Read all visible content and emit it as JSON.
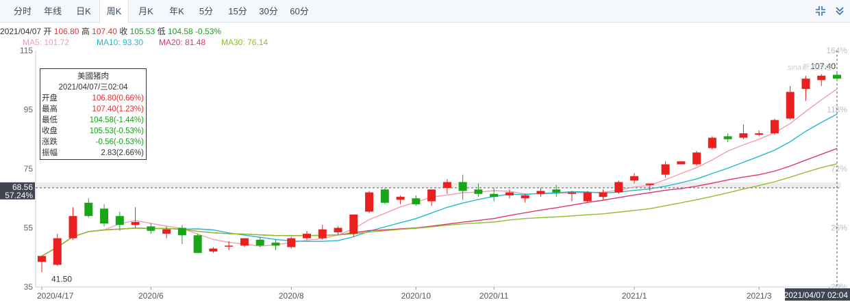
{
  "tabs": [
    {
      "label": "分时",
      "active": false
    },
    {
      "label": "年线",
      "active": false
    },
    {
      "label": "日K",
      "active": false
    },
    {
      "label": "周K",
      "active": true
    },
    {
      "label": "月K",
      "active": false
    },
    {
      "label": "年K",
      "active": false
    },
    {
      "label": "5分",
      "active": false
    },
    {
      "label": "15分",
      "active": false
    },
    {
      "label": "30分",
      "active": false
    },
    {
      "label": "60分",
      "active": false
    }
  ],
  "toolbar": {
    "compress_icon": "compress-icon",
    "arrow_icon": "chevron-down-icon"
  },
  "info": {
    "date": "2021/04/07",
    "open_label": "开",
    "open": "106.80",
    "high_label": "高",
    "high": "107.40",
    "close_label": "收",
    "close": "105.53",
    "low_label": "低",
    "low": "104.58",
    "change_pct": "-0.53%"
  },
  "ma": [
    {
      "label": "MA5: 101.72",
      "color": "#f29db0"
    },
    {
      "label": "MA10: 93.30",
      "color": "#20b8d0"
    },
    {
      "label": "MA20: 81.48",
      "color": "#e0356b"
    },
    {
      "label": "MA30: 76.14",
      "color": "#8fbf2a"
    }
  ],
  "tooltip": {
    "title": "美國猪肉",
    "datetime": "2021/04/07/三02:04",
    "rows": [
      {
        "label": "开盘",
        "value": "106.80(0.66%)",
        "color": "#e03030"
      },
      {
        "label": "最高",
        "value": "107.40(1.23%)",
        "color": "#e03030"
      },
      {
        "label": "最低",
        "value": "104.58(-1.44%)",
        "color": "#1a9e1a"
      },
      {
        "label": "收盘",
        "value": "105.53(-0.53%)",
        "color": "#1a9e1a"
      },
      {
        "label": "涨跌",
        "value": "-0.56(-0.53%)",
        "color": "#1a9e1a"
      },
      {
        "label": "振幅",
        "value": "2.83(2.66%)",
        "color": "#333333"
      }
    ]
  },
  "watermark": "sina新浪财经",
  "crosshair": {
    "price_label": "68.56",
    "pct_label": "57.24%",
    "date_label": "2021/04/07 02:04"
  },
  "chart_data": {
    "type": "candlestick",
    "y_ticks": [
      115,
      95,
      75,
      55,
      35
    ],
    "y_range": [
      35,
      115
    ],
    "pct_ticks": [
      "164%",
      "118%",
      "72%",
      "26%",
      "-20%"
    ],
    "x_tick_labels": [
      "2020/4/17",
      "2020/6",
      "2020/8",
      "2020/10",
      "2020/11",
      "2021/1",
      "2021/3"
    ],
    "x_tick_index": [
      0,
      7,
      16,
      24,
      29,
      38,
      46
    ],
    "max_label": "107.40",
    "min_label": "41.50",
    "crosshair_price": 68.56,
    "candles": [
      {
        "o": 43.5,
        "h": 45.5,
        "l": 40.0,
        "c": 45.5
      },
      {
        "o": 42.5,
        "h": 53.0,
        "l": 42.0,
        "c": 51.5
      },
      {
        "o": 51.5,
        "h": 62.0,
        "l": 51.0,
        "c": 59.0
      },
      {
        "o": 63.5,
        "h": 65.0,
        "l": 58.5,
        "c": 59.0
      },
      {
        "o": 61.5,
        "h": 63.0,
        "l": 55.5,
        "c": 56.5
      },
      {
        "o": 59.0,
        "h": 60.5,
        "l": 54.0,
        "c": 56.0
      },
      {
        "o": 56.0,
        "h": 62.0,
        "l": 55.0,
        "c": 57.0
      },
      {
        "o": 55.5,
        "h": 56.5,
        "l": 53.0,
        "c": 54.0
      },
      {
        "o": 53.0,
        "h": 55.5,
        "l": 51.5,
        "c": 54.5
      },
      {
        "o": 55.0,
        "h": 56.0,
        "l": 49.5,
        "c": 52.5
      },
      {
        "o": 52.5,
        "h": 53.0,
        "l": 46.5,
        "c": 46.5
      },
      {
        "o": 47.0,
        "h": 48.5,
        "l": 46.5,
        "c": 48.0
      },
      {
        "o": 49.0,
        "h": 50.5,
        "l": 47.5,
        "c": 49.0
      },
      {
        "o": 49.0,
        "h": 51.5,
        "l": 48.5,
        "c": 51.5
      },
      {
        "o": 51.0,
        "h": 52.0,
        "l": 48.5,
        "c": 49.0
      },
      {
        "o": 50.0,
        "h": 51.0,
        "l": 47.5,
        "c": 49.0
      },
      {
        "o": 48.5,
        "h": 52.0,
        "l": 48.0,
        "c": 51.5
      },
      {
        "o": 51.5,
        "h": 54.0,
        "l": 51.0,
        "c": 53.0
      },
      {
        "o": 51.5,
        "h": 56.0,
        "l": 51.0,
        "c": 54.5
      },
      {
        "o": 53.5,
        "h": 55.5,
        "l": 52.5,
        "c": 55.0
      },
      {
        "o": 53.0,
        "h": 57.5,
        "l": 52.0,
        "c": 59.5
      },
      {
        "o": 60.5,
        "h": 67.5,
        "l": 60.0,
        "c": 67.0
      },
      {
        "o": 68.0,
        "h": 68.5,
        "l": 63.0,
        "c": 63.5
      },
      {
        "o": 64.5,
        "h": 66.0,
        "l": 63.0,
        "c": 65.5
      },
      {
        "o": 65.0,
        "h": 66.0,
        "l": 62.5,
        "c": 63.0
      },
      {
        "o": 64.0,
        "h": 67.5,
        "l": 62.5,
        "c": 68.0
      },
      {
        "o": 68.5,
        "h": 71.5,
        "l": 66.5,
        "c": 70.5
      },
      {
        "o": 70.5,
        "h": 73.0,
        "l": 64.5,
        "c": 67.5
      },
      {
        "o": 68.0,
        "h": 70.0,
        "l": 65.5,
        "c": 66.5
      },
      {
        "o": 66.5,
        "h": 68.5,
        "l": 64.0,
        "c": 65.5
      },
      {
        "o": 66.0,
        "h": 68.0,
        "l": 65.0,
        "c": 67.0
      },
      {
        "o": 65.0,
        "h": 66.5,
        "l": 63.5,
        "c": 66.0
      },
      {
        "o": 66.5,
        "h": 68.5,
        "l": 65.5,
        "c": 67.5
      },
      {
        "o": 68.0,
        "h": 69.5,
        "l": 65.5,
        "c": 67.0
      },
      {
        "o": 66.5,
        "h": 67.5,
        "l": 64.0,
        "c": 67.0
      },
      {
        "o": 64.0,
        "h": 67.5,
        "l": 63.5,
        "c": 67.0
      },
      {
        "o": 65.5,
        "h": 68.0,
        "l": 64.5,
        "c": 67.0
      },
      {
        "o": 67.0,
        "h": 71.0,
        "l": 66.5,
        "c": 70.5
      },
      {
        "o": 71.0,
        "h": 73.5,
        "l": 70.0,
        "c": 72.5
      },
      {
        "o": 69.5,
        "h": 70.0,
        "l": 67.5,
        "c": 70.0
      },
      {
        "o": 73.0,
        "h": 77.5,
        "l": 72.0,
        "c": 76.5
      },
      {
        "o": 76.5,
        "h": 77.5,
        "l": 76.5,
        "c": 77.5
      },
      {
        "o": 76.5,
        "h": 81.0,
        "l": 76.0,
        "c": 80.5
      },
      {
        "o": 82.0,
        "h": 86.0,
        "l": 81.5,
        "c": 85.5
      },
      {
        "o": 86.0,
        "h": 87.0,
        "l": 84.0,
        "c": 85.0
      },
      {
        "o": 85.5,
        "h": 90.0,
        "l": 85.0,
        "c": 87.0
      },
      {
        "o": 86.5,
        "h": 88.0,
        "l": 86.0,
        "c": 87.0
      },
      {
        "o": 87.0,
        "h": 92.0,
        "l": 86.5,
        "c": 91.5
      },
      {
        "o": 92.0,
        "h": 103.0,
        "l": 91.5,
        "c": 101.0
      },
      {
        "o": 102.0,
        "h": 106.5,
        "l": 98.0,
        "c": 105.5
      },
      {
        "o": 105.0,
        "h": 107.0,
        "l": 103.0,
        "c": 106.5
      },
      {
        "o": 106.8,
        "h": 107.4,
        "l": 104.58,
        "c": 105.53
      }
    ],
    "ma_series": [
      {
        "name": "MA5",
        "color": "#f29db0"
      },
      {
        "name": "MA10",
        "color": "#20b8d0"
      },
      {
        "name": "MA20",
        "color": "#e0356b"
      },
      {
        "name": "MA30",
        "color": "#8fbf2a"
      }
    ],
    "up_color": "#e82020",
    "down_color": "#19a519"
  }
}
